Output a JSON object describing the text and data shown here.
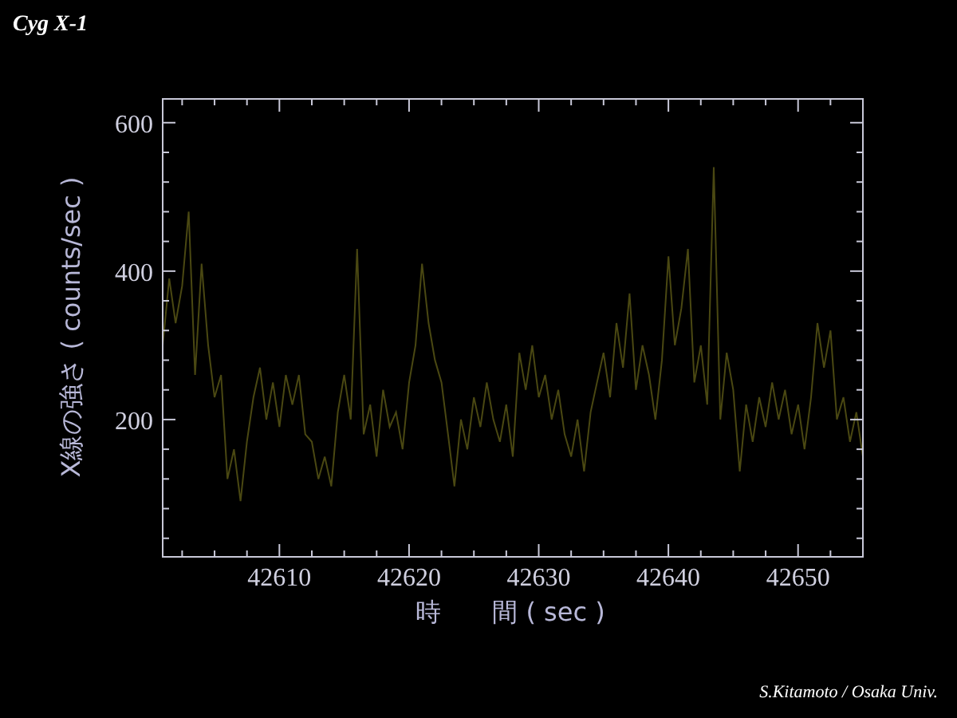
{
  "chart_data": {
    "type": "line",
    "title": "Cyg X-1",
    "xlabel": "時　　間 ( sec )",
    "ylabel": "X線の強さ ( counts/sec )",
    "x": [
      42601,
      42601.5,
      42602,
      42602.5,
      42603,
      42603.5,
      42604,
      42604.5,
      42605,
      42605.5,
      42606,
      42606.5,
      42607,
      42607.5,
      42608,
      42608.5,
      42609,
      42609.5,
      42610,
      42610.5,
      42611,
      42611.5,
      42612,
      42612.5,
      42613,
      42613.5,
      42614,
      42614.5,
      42615,
      42615.5,
      42616,
      42616.5,
      42617,
      42617.5,
      42618,
      42618.5,
      42619,
      42619.5,
      42620,
      42620.5,
      42621,
      42621.5,
      42622,
      42622.5,
      42623,
      42623.5,
      42624,
      42624.5,
      42625,
      42625.5,
      42626,
      42626.5,
      42627,
      42627.5,
      42628,
      42628.5,
      42629,
      42629.5,
      42630,
      42630.5,
      42631,
      42631.5,
      42632,
      42632.5,
      42633,
      42633.5,
      42634,
      42634.5,
      42635,
      42635.5,
      42636,
      42636.5,
      42637,
      42637.5,
      42638,
      42638.5,
      42639,
      42639.5,
      42640,
      42640.5,
      42641,
      42641.5,
      42642,
      42642.5,
      42643,
      42643.5,
      42644,
      42644.5,
      42645,
      42645.5,
      42646,
      42646.5,
      42647,
      42647.5,
      42648,
      42648.5,
      42649,
      42649.5,
      42650,
      42650.5,
      42651,
      42651.5,
      42652,
      42652.5,
      42653,
      42653.5,
      42654,
      42654.5,
      42655
    ],
    "series": [
      {
        "color": "#4a4812",
        "values": [
          300,
          390,
          330,
          380,
          480,
          260,
          410,
          300,
          230,
          260,
          120,
          160,
          90,
          170,
          230,
          270,
          200,
          250,
          190,
          260,
          220,
          260,
          180,
          170,
          120,
          150,
          110,
          210,
          260,
          200,
          430,
          180,
          220,
          150,
          240,
          190,
          210,
          160,
          250,
          300,
          410,
          330,
          280,
          250,
          180,
          110,
          200,
          160,
          230,
          190,
          250,
          200,
          170,
          220,
          150,
          290,
          240,
          300,
          230,
          260,
          200,
          240,
          180,
          150,
          200,
          130,
          210,
          250,
          290,
          230,
          330,
          270,
          370,
          240,
          300,
          260,
          200,
          280,
          420,
          300,
          350,
          430,
          250,
          300,
          220,
          540,
          200,
          290,
          240,
          130,
          220,
          170,
          230,
          190,
          250,
          200,
          240,
          180,
          220,
          160,
          230,
          330,
          270,
          320,
          200,
          230,
          170,
          210,
          150
        ]
      }
    ],
    "xlim": [
      42601,
      42655
    ],
    "ylim": [
      15,
      632
    ],
    "xticks": [
      42610,
      42620,
      42630,
      42640,
      42650
    ],
    "yticks": [
      200,
      400,
      600
    ]
  },
  "credit": "S.Kitamoto / Osaka Univ."
}
